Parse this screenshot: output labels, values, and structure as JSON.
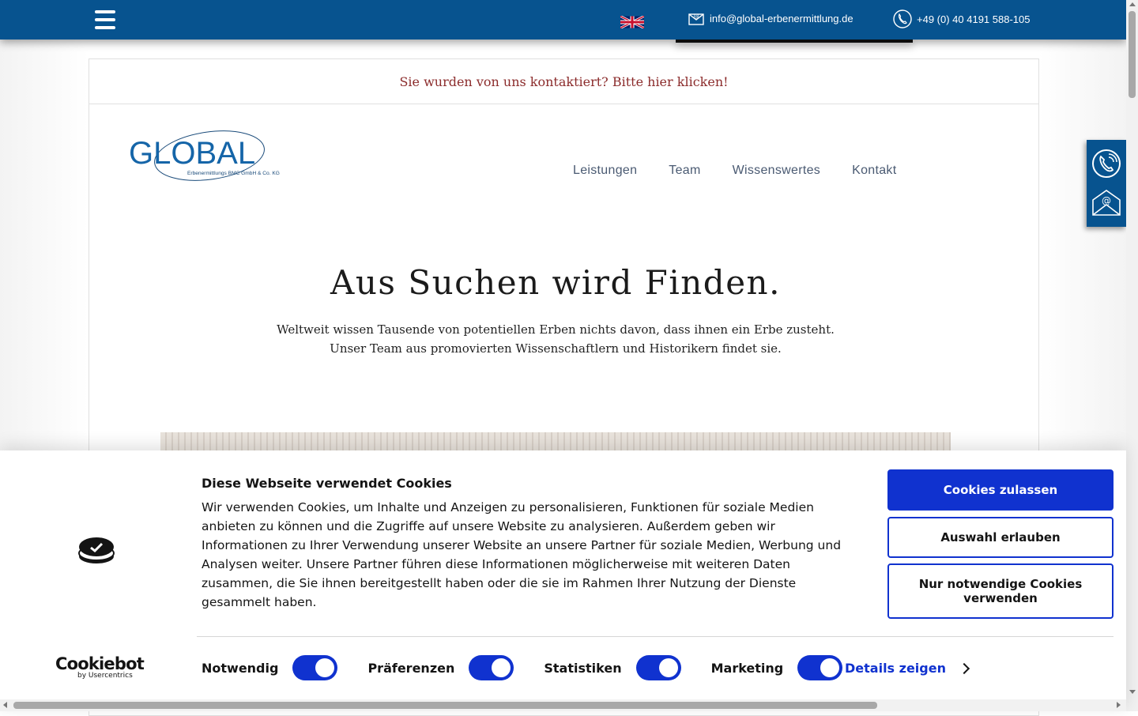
{
  "topbar": {
    "email": "info@global-erbenermittlung.de",
    "phone": "+49 (0) 40 4191 588-105",
    "language_flag": "uk-flag-icon",
    "menu_icon": "hamburger-menu-icon",
    "background_color": "#07538f"
  },
  "notice": {
    "text": "Sie wurden von uns kontaktiert? Bitte hier klicken!",
    "color": "#8b2b2b"
  },
  "logo": {
    "main": "GLOBAL",
    "sub": "Erbenermittlungs BMC GmbH & Co. KG"
  },
  "nav": {
    "items": [
      "Leistungen",
      "Team",
      "Wissenswertes",
      "Kontakt"
    ]
  },
  "hero": {
    "title": "Aus Suchen wird Finden.",
    "line1": "Weltweit wissen Tausende von potentiellen Erben nichts davon, dass ihnen ein Erbe zusteht.",
    "line2": "Unser Team aus promovierten Wissenschaftlern und Historikern findet sie."
  },
  "side_contact": {
    "icons": [
      "phone-icon",
      "email-icon"
    ]
  },
  "cookie_banner": {
    "title": "Diese Webseite verwendet Cookies",
    "text": "Wir verwenden Cookies, um Inhalte und Anzeigen zu personalisieren, Funktionen für soziale Medien anbieten zu können und die Zugriffe auf unsere Website zu analysieren. Außerdem geben wir Informationen zu Ihrer Verwendung unserer Website an unsere Partner für soziale Medien, Werbung und Analysen weiter. Unsere Partner führen diese Informationen möglicherweise mit weiteren Daten zusammen, die Sie ihnen bereitgestellt haben oder die sie im Rahmen Ihrer Nutzung der Dienste gesammelt haben.",
    "brand": "Cookiebot",
    "brand_by": "by Usercentrics",
    "buttons": {
      "allow_all": "Cookies zulassen",
      "allow_selection": "Auswahl erlauben",
      "necessary_only": "Nur notwendige Cookies verwenden"
    },
    "toggles": [
      {
        "label": "Notwendig",
        "on": true
      },
      {
        "label": "Präferenzen",
        "on": true
      },
      {
        "label": "Statistiken",
        "on": true
      },
      {
        "label": "Marketing",
        "on": true
      }
    ],
    "details_link": "Details zeigen",
    "accent_color": "#1032cf"
  }
}
